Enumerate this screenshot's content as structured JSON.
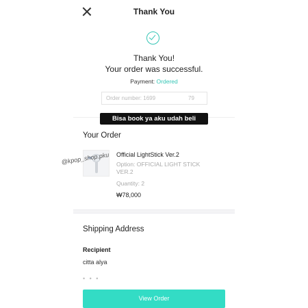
{
  "header": {
    "title": "Thank You"
  },
  "confirmation": {
    "line1": "Thank You!",
    "line2": "Your order was successful.",
    "payment_label": "Payment:",
    "payment_status": "Ordered",
    "order_number_text": "Order number: 1699            79"
  },
  "overlay": {
    "sticker_text": "Bisa book ya aku udah beli",
    "watermark_text": "@kpop_shop.pku"
  },
  "order": {
    "section_title": "Your Order",
    "product": {
      "name": "Official LightStick Ver.2",
      "option_line1": "Option: OFFICIAL LIGHT STICK",
      "option_line2": "VER.2",
      "quantity": "Quantity: 2",
      "price": "₩78,000"
    }
  },
  "shipping": {
    "section_title": "Shipping Address",
    "recipient_label": "Recipient",
    "recipient_name": "citta alya",
    "more": "• • •"
  },
  "actions": {
    "view_order_label": "View Order"
  },
  "colors": {
    "accent": "#35c5b5",
    "button": "#33dcc5"
  }
}
